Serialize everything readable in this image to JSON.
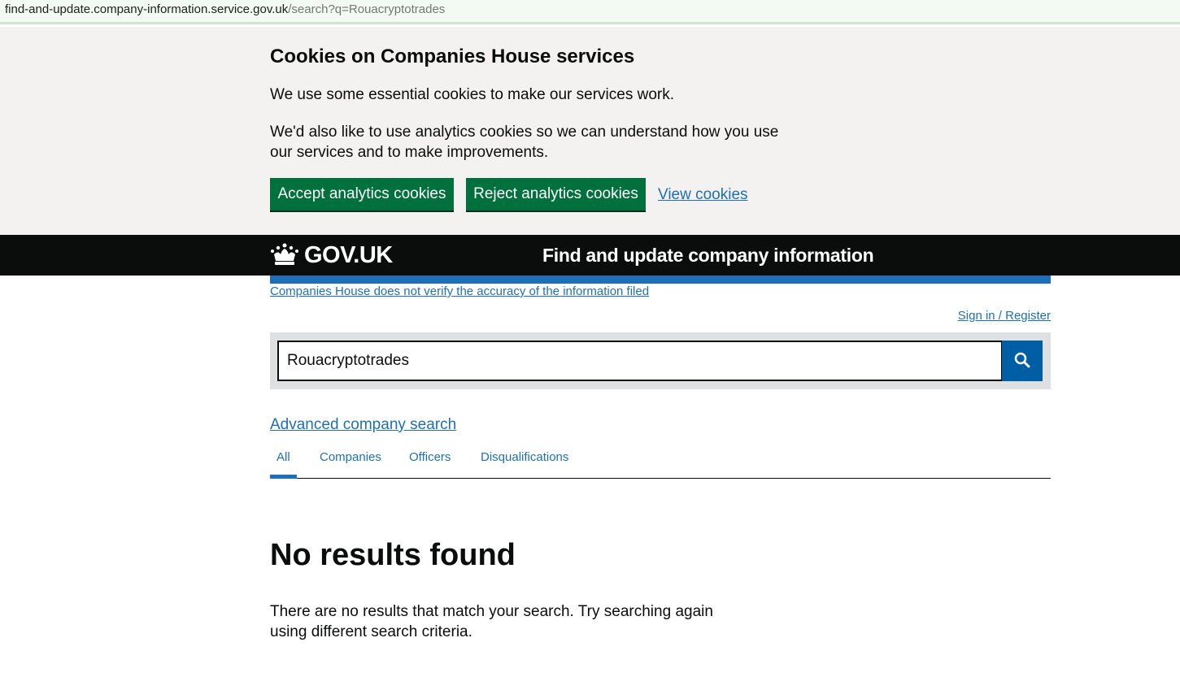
{
  "browser": {
    "url_host": "find-and-update.company-information.service.gov.uk",
    "url_path": "/search?q=Rouacryptotrades"
  },
  "cookie_banner": {
    "title": "Cookies on Companies House services",
    "para1": "We use some essential cookies to make our services work.",
    "para2": "We'd also like to use analytics cookies so we can understand how you use our services and to make improvements.",
    "accept_label": "Accept analytics cookies",
    "reject_label": "Reject analytics cookies",
    "view_label": "View cookies"
  },
  "header": {
    "logo_text": "GOV.UK",
    "service_name": "Find and update company information",
    "crown_icon": "crown-icon"
  },
  "disclaimer": "Companies House does not verify the accuracy of the information filed",
  "sign_in": "Sign in / Register",
  "search": {
    "value": "Rouacryptotrades",
    "icon": "search-icon"
  },
  "advanced_search": "Advanced company search",
  "tabs": [
    {
      "label": "All",
      "active": true
    },
    {
      "label": "Companies",
      "active": false
    },
    {
      "label": "Officers",
      "active": false
    },
    {
      "label": "Disqualifications",
      "active": false
    }
  ],
  "results": {
    "heading": "No results found",
    "message": "There are no results that match your search. Try searching again using different search criteria."
  },
  "colors": {
    "green": "#00703c",
    "link": "#1d70b8",
    "header_bg": "#0b0c0c",
    "banner_bg": "#f3f2f1"
  }
}
